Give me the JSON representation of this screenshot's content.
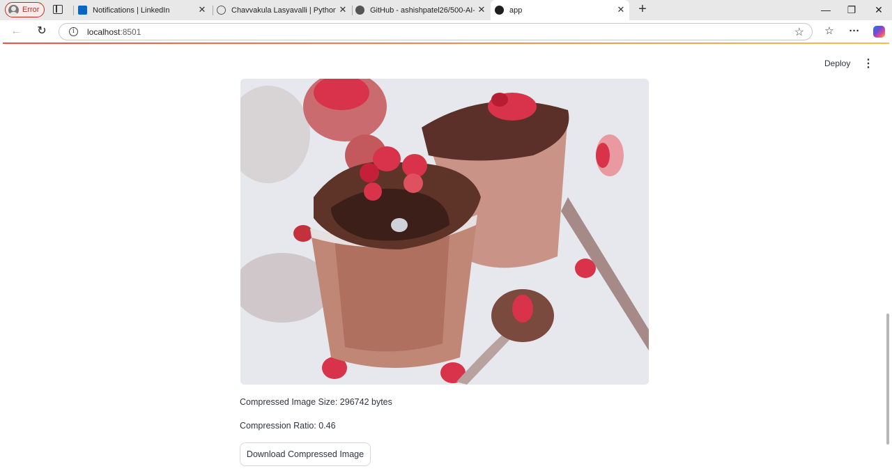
{
  "browser": {
    "profile_label": "Error",
    "tabs": [
      {
        "title": "Notifications | LinkedIn",
        "icon": "linkedin-icon"
      },
      {
        "title": "Chavvakula Lasyavalli | Python De",
        "icon": "globe-icon"
      },
      {
        "title": "GitHub - ashishpatel26/500-AI-M",
        "icon": "github-icon"
      },
      {
        "title": "app",
        "icon": "streamlit-icon",
        "active": true
      }
    ],
    "url_host": "localhost",
    "url_port": ":8501"
  },
  "app": {
    "deploy_label": "Deploy",
    "image_alt": "Compressed image: chocolate mousse cups topped with pomegranate seeds",
    "compressed_size_text": "Compressed Image Size: 296742 bytes",
    "compression_ratio_text": "Compression Ratio: 0.46",
    "download_label": "Download Compressed Image"
  },
  "colors": {
    "accent": "#ff4b4b",
    "text": "#31333f",
    "error": "#c42b1c"
  }
}
